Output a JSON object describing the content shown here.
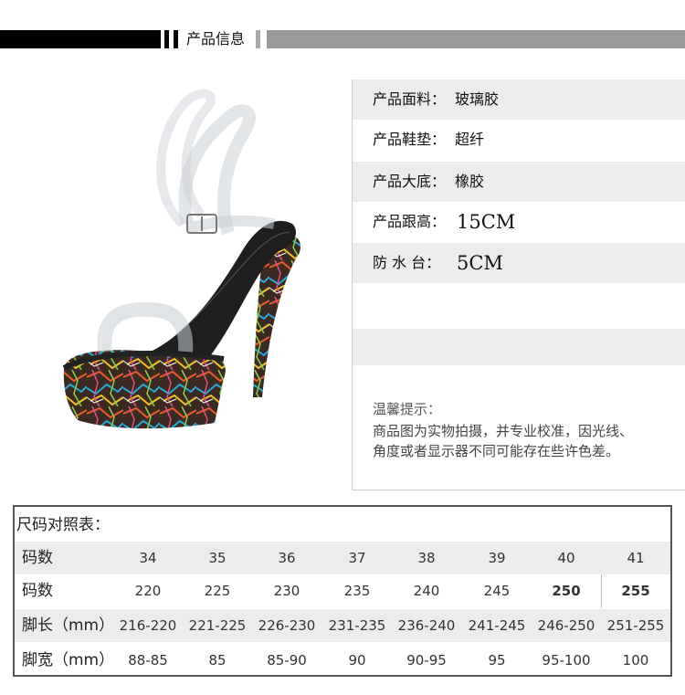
{
  "header": {
    "title": "产品信息"
  },
  "info": {
    "rows": [
      {
        "label": "产品面料：",
        "value": "玻璃胶"
      },
      {
        "label": "产品鞋垫：",
        "value": "超纤"
      },
      {
        "label": "产品大底：",
        "value": "橡胶"
      },
      {
        "label": "产品跟高：",
        "value": "15CM"
      },
      {
        "label": "防 水 台：",
        "value": "5CM"
      }
    ],
    "tip_title": "温馨提示：",
    "tip_lines": [
      "商品图为实物拍摄，并专业校准，因光线、",
      "角度或者显示器不同可能存在些许色差。"
    ]
  },
  "size_table": {
    "title": "尺码对照表：",
    "rows": [
      {
        "header": "码数",
        "cells": [
          "34",
          "35",
          "36",
          "37",
          "38",
          "39",
          "40",
          "41"
        ]
      },
      {
        "header": "码数",
        "cells": [
          "220",
          "225",
          "230",
          "235",
          "240",
          "245",
          "250",
          "255"
        ]
      },
      {
        "header": "脚长（mm）",
        "cells": [
          "216-220",
          "221-225",
          "226-230",
          "231-235",
          "236-240",
          "241-245",
          "246-250",
          "251-255"
        ]
      },
      {
        "header": "脚宽（mm）",
        "cells": [
          "88-85",
          "85",
          "85-90",
          "90",
          "90-95",
          "95",
          "95-100",
          "100"
        ]
      }
    ]
  },
  "colors": {
    "header_black": "#000000",
    "header_gray": "#999999",
    "row_shade": "#ececec",
    "table_border": "#555555"
  }
}
